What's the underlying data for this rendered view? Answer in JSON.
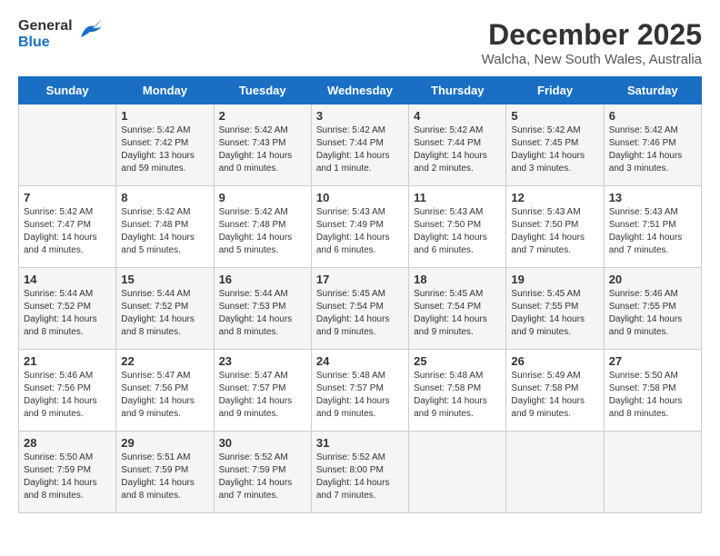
{
  "logo": {
    "line1": "General",
    "line2": "Blue"
  },
  "title": "December 2025",
  "subtitle": "Walcha, New South Wales, Australia",
  "weekdays": [
    "Sunday",
    "Monday",
    "Tuesday",
    "Wednesday",
    "Thursday",
    "Friday",
    "Saturday"
  ],
  "weeks": [
    [
      {
        "day": "",
        "info": ""
      },
      {
        "day": "1",
        "info": "Sunrise: 5:42 AM\nSunset: 7:42 PM\nDaylight: 13 hours\nand 59 minutes."
      },
      {
        "day": "2",
        "info": "Sunrise: 5:42 AM\nSunset: 7:43 PM\nDaylight: 14 hours\nand 0 minutes."
      },
      {
        "day": "3",
        "info": "Sunrise: 5:42 AM\nSunset: 7:44 PM\nDaylight: 14 hours\nand 1 minute."
      },
      {
        "day": "4",
        "info": "Sunrise: 5:42 AM\nSunset: 7:44 PM\nDaylight: 14 hours\nand 2 minutes."
      },
      {
        "day": "5",
        "info": "Sunrise: 5:42 AM\nSunset: 7:45 PM\nDaylight: 14 hours\nand 3 minutes."
      },
      {
        "day": "6",
        "info": "Sunrise: 5:42 AM\nSunset: 7:46 PM\nDaylight: 14 hours\nand 3 minutes."
      }
    ],
    [
      {
        "day": "7",
        "info": "Sunrise: 5:42 AM\nSunset: 7:47 PM\nDaylight: 14 hours\nand 4 minutes."
      },
      {
        "day": "8",
        "info": "Sunrise: 5:42 AM\nSunset: 7:48 PM\nDaylight: 14 hours\nand 5 minutes."
      },
      {
        "day": "9",
        "info": "Sunrise: 5:42 AM\nSunset: 7:48 PM\nDaylight: 14 hours\nand 5 minutes."
      },
      {
        "day": "10",
        "info": "Sunrise: 5:43 AM\nSunset: 7:49 PM\nDaylight: 14 hours\nand 6 minutes."
      },
      {
        "day": "11",
        "info": "Sunrise: 5:43 AM\nSunset: 7:50 PM\nDaylight: 14 hours\nand 6 minutes."
      },
      {
        "day": "12",
        "info": "Sunrise: 5:43 AM\nSunset: 7:50 PM\nDaylight: 14 hours\nand 7 minutes."
      },
      {
        "day": "13",
        "info": "Sunrise: 5:43 AM\nSunset: 7:51 PM\nDaylight: 14 hours\nand 7 minutes."
      }
    ],
    [
      {
        "day": "14",
        "info": "Sunrise: 5:44 AM\nSunset: 7:52 PM\nDaylight: 14 hours\nand 8 minutes."
      },
      {
        "day": "15",
        "info": "Sunrise: 5:44 AM\nSunset: 7:52 PM\nDaylight: 14 hours\nand 8 minutes."
      },
      {
        "day": "16",
        "info": "Sunrise: 5:44 AM\nSunset: 7:53 PM\nDaylight: 14 hours\nand 8 minutes."
      },
      {
        "day": "17",
        "info": "Sunrise: 5:45 AM\nSunset: 7:54 PM\nDaylight: 14 hours\nand 9 minutes."
      },
      {
        "day": "18",
        "info": "Sunrise: 5:45 AM\nSunset: 7:54 PM\nDaylight: 14 hours\nand 9 minutes."
      },
      {
        "day": "19",
        "info": "Sunrise: 5:45 AM\nSunset: 7:55 PM\nDaylight: 14 hours\nand 9 minutes."
      },
      {
        "day": "20",
        "info": "Sunrise: 5:46 AM\nSunset: 7:55 PM\nDaylight: 14 hours\nand 9 minutes."
      }
    ],
    [
      {
        "day": "21",
        "info": "Sunrise: 5:46 AM\nSunset: 7:56 PM\nDaylight: 14 hours\nand 9 minutes."
      },
      {
        "day": "22",
        "info": "Sunrise: 5:47 AM\nSunset: 7:56 PM\nDaylight: 14 hours\nand 9 minutes."
      },
      {
        "day": "23",
        "info": "Sunrise: 5:47 AM\nSunset: 7:57 PM\nDaylight: 14 hours\nand 9 minutes."
      },
      {
        "day": "24",
        "info": "Sunrise: 5:48 AM\nSunset: 7:57 PM\nDaylight: 14 hours\nand 9 minutes."
      },
      {
        "day": "25",
        "info": "Sunrise: 5:48 AM\nSunset: 7:58 PM\nDaylight: 14 hours\nand 9 minutes."
      },
      {
        "day": "26",
        "info": "Sunrise: 5:49 AM\nSunset: 7:58 PM\nDaylight: 14 hours\nand 9 minutes."
      },
      {
        "day": "27",
        "info": "Sunrise: 5:50 AM\nSunset: 7:58 PM\nDaylight: 14 hours\nand 8 minutes."
      }
    ],
    [
      {
        "day": "28",
        "info": "Sunrise: 5:50 AM\nSunset: 7:59 PM\nDaylight: 14 hours\nand 8 minutes."
      },
      {
        "day": "29",
        "info": "Sunrise: 5:51 AM\nSunset: 7:59 PM\nDaylight: 14 hours\nand 8 minutes."
      },
      {
        "day": "30",
        "info": "Sunrise: 5:52 AM\nSunset: 7:59 PM\nDaylight: 14 hours\nand 7 minutes."
      },
      {
        "day": "31",
        "info": "Sunrise: 5:52 AM\nSunset: 8:00 PM\nDaylight: 14 hours\nand 7 minutes."
      },
      {
        "day": "",
        "info": ""
      },
      {
        "day": "",
        "info": ""
      },
      {
        "day": "",
        "info": ""
      }
    ]
  ]
}
